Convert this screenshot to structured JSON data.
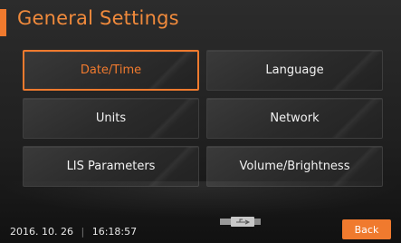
{
  "header": {
    "title": "General Settings"
  },
  "menu": {
    "items": [
      {
        "label": "Date/Time",
        "selected": true
      },
      {
        "label": "Language",
        "selected": false
      },
      {
        "label": "Units",
        "selected": false
      },
      {
        "label": "Network",
        "selected": false
      },
      {
        "label": "LIS Parameters",
        "selected": false
      },
      {
        "label": "Volume/Brightness",
        "selected": false
      }
    ]
  },
  "status": {
    "date": "2016. 10. 26",
    "separator": "|",
    "time": "16:18:57",
    "usb_icon": "usb-drive-icon"
  },
  "footer": {
    "back_label": "Back"
  },
  "colors": {
    "accent": "#f07a2e",
    "background": "#1f1f1f",
    "button": "#2e2e2e"
  }
}
